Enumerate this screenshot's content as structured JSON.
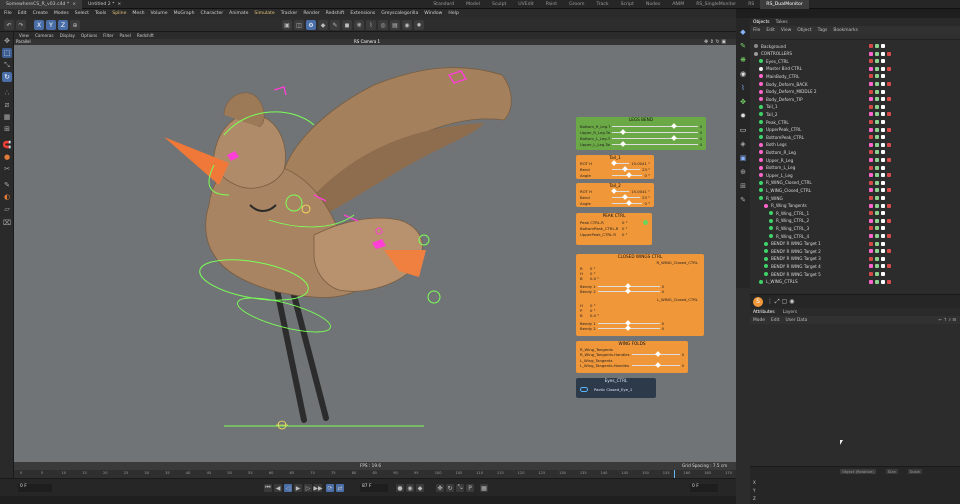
{
  "window": {
    "tabs": [
      {
        "label": "SomewhereCS_R_v03.c4d *",
        "active": true
      },
      {
        "label": "Untitled 2 *",
        "active": false
      }
    ],
    "layouts": [
      "Standard",
      "Model",
      "Sculpt",
      "UVEdit",
      "Paint",
      "Groom",
      "Track",
      "Script",
      "Nodes",
      "ANIM",
      "RS_SingleMonitor",
      "RS",
      "RS_DualMonitor"
    ],
    "active_layout": "RS_DualMonitor"
  },
  "menubar": [
    "File",
    "Edit",
    "Create",
    "Modes",
    "Select",
    "Tools",
    "Spline",
    "Mesh",
    "Volume",
    "MoGraph",
    "Character",
    "Animate",
    "Simulate",
    "Tracker",
    "Render",
    "Redshift",
    "Extensions",
    "Greyscalegorilla",
    "Window",
    "Help"
  ],
  "viewport": {
    "menu": [
      "View",
      "Cameras",
      "Display",
      "Options",
      "Filter",
      "Panel",
      "Redshift"
    ],
    "mode_label": "Parallel",
    "camera_label": "RS Camera 1",
    "fps": "FPS : 19.6",
    "grid_spacing": "Grid Spacing : 7.5 cm"
  },
  "panels": {
    "legs": {
      "title": "LEGS BEND",
      "rows": [
        {
          "label": "Bottom_R_Leg.Tangent Bottom_R_Leg",
          "value": "0"
        },
        {
          "label": "Upper_R_Leg.Tangent Upper_R_Leg",
          "value": "0"
        },
        {
          "label": "Bottom_L_Leg.Tangent Bottom_L_Leg",
          "value": "0"
        },
        {
          "label": "Upper_L_Leg.Tangent Upper_L_Leg",
          "value": "0"
        }
      ]
    },
    "tail1": {
      "title": "Tail_1",
      "rows": [
        {
          "label": "ROT H",
          "value": "15.0041 °"
        },
        {
          "label": "Bend",
          "value": "23 °"
        },
        {
          "label": "Angle",
          "value": "0 °"
        }
      ]
    },
    "tail2": {
      "title": "Tail_2",
      "rows": [
        {
          "label": "ROT H",
          "value": "15.0041 °"
        },
        {
          "label": "Bend",
          "value": "23 °"
        },
        {
          "label": "Angle",
          "value": "0 °"
        }
      ]
    },
    "peak": {
      "title": "PEAK CTRL",
      "rows": [
        {
          "label": "Peak CTRL.R",
          "value": "0 °"
        },
        {
          "label": "BottomPeak_CTRL.R",
          "value": "0 °"
        },
        {
          "label": "UpperPeak_CTRL.R",
          "value": "0 °"
        }
      ]
    },
    "wings": {
      "title": "CLOSED WINGS CTRL",
      "right_label": "R_WING_Closed_CTRL",
      "left_label": "L_WING_Closed_CTRL",
      "rows_r": [
        {
          "label": "R",
          "value": "0 °"
        },
        {
          "label": "H",
          "value": "0 °"
        },
        {
          "label": "B",
          "value": "0.0 °"
        },
        {
          "label": "Bendy 1",
          "value": "0"
        },
        {
          "label": "Bendy 2",
          "value": "0"
        }
      ],
      "rows_l": [
        {
          "label": "H",
          "value": "0 °"
        },
        {
          "label": "P",
          "value": "0 °"
        },
        {
          "label": "B",
          "value": "0.0 °"
        },
        {
          "label": "Bendy 1",
          "value": "0"
        },
        {
          "label": "Bendy 2",
          "value": "0"
        }
      ]
    },
    "wing_folds": {
      "title": "WING FOLDS",
      "rows": [
        {
          "label": "R_Wing_Tangents",
          "value": ""
        },
        {
          "label": "R_Wing_Tangents.Handles",
          "value": "0"
        },
        {
          "label": "L_Wing_Tangents",
          "value": ""
        },
        {
          "label": "L_Wing_Tangents.Handles",
          "value": "0"
        }
      ]
    },
    "eyes": {
      "title": "Eyes_CTRL",
      "toggle": "Pactic Closed_Eye_1"
    }
  },
  "object_manager": {
    "tabs": [
      "Objects",
      "Takes"
    ],
    "menu": [
      "File",
      "Edit",
      "View",
      "Object",
      "Tags",
      "Bookmarks"
    ],
    "items": [
      {
        "name": "Background",
        "color": "#8a8a8a",
        "indent": 0
      },
      {
        "name": "CONTROLLERS",
        "color": "#9b9b9b",
        "indent": 0
      },
      {
        "name": "Eyes_CTRL",
        "color": "#3fd36a",
        "indent": 1
      },
      {
        "name": "Master Bird CTRL",
        "color": "#f0f0f0",
        "indent": 1
      },
      {
        "name": "MainBody_CTRL",
        "color": "#ff66cc",
        "indent": 1
      },
      {
        "name": "Body_Deform_BACK",
        "color": "#ff66cc",
        "indent": 1
      },
      {
        "name": "Body_Deform_MIDDLE 2",
        "color": "#ff66cc",
        "indent": 1
      },
      {
        "name": "Body_Deform_TIP",
        "color": "#ff66cc",
        "indent": 1
      },
      {
        "name": "Tail_1",
        "color": "#3fd36a",
        "indent": 1
      },
      {
        "name": "Tail_2",
        "color": "#3fd36a",
        "indent": 1
      },
      {
        "name": "Peak_CTRL",
        "color": "#3fd36a",
        "indent": 1
      },
      {
        "name": "UpperPeak_CTRL",
        "color": "#3fd36a",
        "indent": 1
      },
      {
        "name": "BottomPeak_CTRL",
        "color": "#3fd36a",
        "indent": 1
      },
      {
        "name": "Both Legs",
        "color": "#ff66cc",
        "indent": 1
      },
      {
        "name": "Bottom_R_Leg",
        "color": "#ff66cc",
        "indent": 1
      },
      {
        "name": "Upper_R_Leg",
        "color": "#ff66cc",
        "indent": 1
      },
      {
        "name": "Bottom_L_Leg",
        "color": "#ff66cc",
        "indent": 1
      },
      {
        "name": "Upper_L_Leg",
        "color": "#ff66cc",
        "indent": 1
      },
      {
        "name": "R_WING_Closed_CTRL",
        "color": "#3fd36a",
        "indent": 1
      },
      {
        "name": "L_WING_Closed_CTRL",
        "color": "#3fd36a",
        "indent": 1
      },
      {
        "name": "R_WING",
        "color": "#3fd36a",
        "indent": 1
      },
      {
        "name": "R_Wing Tangents",
        "color": "#ff66cc",
        "indent": 2
      },
      {
        "name": "R_Wing_CTRL_1",
        "color": "#3fd36a",
        "indent": 3
      },
      {
        "name": "R_Wing_CTRL_2",
        "color": "#3fd36a",
        "indent": 3
      },
      {
        "name": "R_Wing_CTRL_3",
        "color": "#3fd36a",
        "indent": 3
      },
      {
        "name": "R_Wing_CTRL_4",
        "color": "#3fd36a",
        "indent": 3
      },
      {
        "name": "BENDY R WING Target 1",
        "color": "#3fd36a",
        "indent": 2
      },
      {
        "name": "BENDY R WING Target 2",
        "color": "#3fd36a",
        "indent": 2
      },
      {
        "name": "BENDY R WING Target 3",
        "color": "#3fd36a",
        "indent": 2
      },
      {
        "name": "BENDY R WING Target 4",
        "color": "#3fd36a",
        "indent": 2
      },
      {
        "name": "BENDY R WING Target 5",
        "color": "#3fd36a",
        "indent": 2
      },
      {
        "name": "L_WING_CTRLS",
        "color": "#3fd36a",
        "indent": 1
      }
    ]
  },
  "attributes": {
    "tabs": [
      "Attributes",
      "Layers"
    ],
    "menu": [
      "Mode",
      "Edit",
      "User Data"
    ]
  },
  "transport": {
    "frame_start": "0 F",
    "frame_current": "87 F",
    "frame_end": "0 F",
    "tick_labels": [
      "0",
      "5",
      "10",
      "15",
      "20",
      "25",
      "30",
      "35",
      "40",
      "45",
      "50",
      "55",
      "60",
      "65",
      "70",
      "75",
      "80",
      "85",
      "90",
      "95",
      "100",
      "105",
      "110",
      "115",
      "120",
      "125",
      "130",
      "135",
      "140",
      "145",
      "150",
      "155",
      "160",
      "165",
      "170"
    ]
  },
  "coords": {
    "headers": [
      "Object (Relative)",
      "Size",
      "Scale"
    ],
    "rows": [
      "X",
      "Y",
      "Z"
    ]
  }
}
